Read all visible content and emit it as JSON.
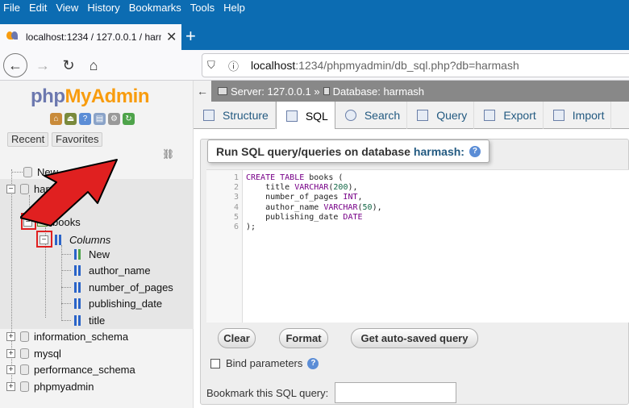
{
  "menubar": {
    "items": [
      "File",
      "Edit",
      "View",
      "History",
      "Bookmarks",
      "Tools",
      "Help"
    ]
  },
  "browser": {
    "tab_title": "localhost:1234 / 127.0.0.1 / harm",
    "url_host": "localhost",
    "url_rest": ":1234/phpmyadmin/db_sql.php?db=harmash"
  },
  "sidebar": {
    "logo_php": "php",
    "logo_myadmin": "MyAdmin",
    "recent_label": "Recent",
    "favorites_label": "Favorites",
    "tree": {
      "new_label": "New",
      "db_harmash": "harm",
      "table_books": "books",
      "columns_label": "Columns",
      "col_new": "New",
      "columns": [
        "author_name",
        "number_of_pages",
        "publishing_date",
        "title"
      ],
      "other_dbs": [
        "information_schema",
        "mysql",
        "performance_schema",
        "phpmyadmin"
      ]
    }
  },
  "breadcrumb": {
    "server": "Server: 127.0.0.1 »",
    "database": "Database: harmash"
  },
  "topmenu": {
    "tabs": [
      "Structure",
      "SQL",
      "Search",
      "Query",
      "Export",
      "Import"
    ]
  },
  "sql_panel": {
    "legend_text": "Run SQL query/queries on database",
    "legend_db": "harmash:",
    "code_lines": [
      "1",
      "2",
      "3",
      "4",
      "5",
      "6"
    ],
    "buttons": {
      "clear": "Clear",
      "format": "Format",
      "autosaved": "Get auto-saved query"
    },
    "bind_parameters": "Bind parameters",
    "bookmark_label": "Bookmark this SQL query:"
  },
  "colors": {
    "menubar": "#0c6cb2",
    "link": "#235a81",
    "arrow": "#e02020"
  }
}
